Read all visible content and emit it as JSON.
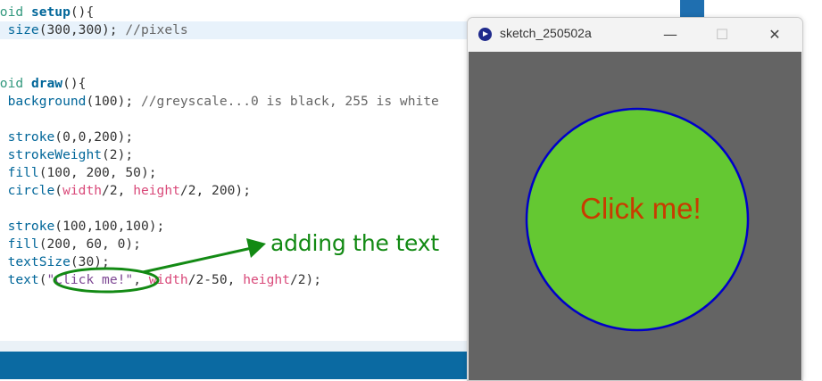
{
  "editor": {
    "lines": [
      [
        {
          "t": "void ",
          "c": "kw"
        },
        {
          "t": "setup",
          "c": "fn"
        },
        {
          "t": "(){",
          "c": ""
        }
      ],
      [
        {
          "t": "  ",
          "c": ""
        },
        {
          "t": "size",
          "c": "fc"
        },
        {
          "t": "(300,300); ",
          "c": ""
        },
        {
          "t": "//pixels",
          "c": "cm"
        }
      ],
      [
        {
          "t": "}",
          "c": ""
        }
      ],
      [
        {
          "t": "",
          "c": ""
        }
      ],
      [
        {
          "t": "void ",
          "c": "kw"
        },
        {
          "t": "draw",
          "c": "fn"
        },
        {
          "t": "(){",
          "c": ""
        }
      ],
      [
        {
          "t": "  ",
          "c": ""
        },
        {
          "t": "background",
          "c": "fc"
        },
        {
          "t": "(100); ",
          "c": ""
        },
        {
          "t": "//greyscale...0 is black, 255 is white",
          "c": "cm"
        }
      ],
      [
        {
          "t": "",
          "c": ""
        }
      ],
      [
        {
          "t": "  ",
          "c": ""
        },
        {
          "t": "stroke",
          "c": "fc"
        },
        {
          "t": "(0,0,200);",
          "c": ""
        }
      ],
      [
        {
          "t": "  ",
          "c": ""
        },
        {
          "t": "strokeWeight",
          "c": "fc"
        },
        {
          "t": "(2);",
          "c": ""
        }
      ],
      [
        {
          "t": "  ",
          "c": ""
        },
        {
          "t": "fill",
          "c": "fc"
        },
        {
          "t": "(100, 200, 50);",
          "c": ""
        }
      ],
      [
        {
          "t": "  ",
          "c": ""
        },
        {
          "t": "circle",
          "c": "fc"
        },
        {
          "t": "(",
          "c": ""
        },
        {
          "t": "width",
          "c": "var"
        },
        {
          "t": "/2, ",
          "c": ""
        },
        {
          "t": "height",
          "c": "var"
        },
        {
          "t": "/2, 200);",
          "c": ""
        }
      ],
      [
        {
          "t": "",
          "c": ""
        }
      ],
      [
        {
          "t": "  ",
          "c": ""
        },
        {
          "t": "stroke",
          "c": "fc"
        },
        {
          "t": "(100,100,100);",
          "c": ""
        }
      ],
      [
        {
          "t": "  ",
          "c": ""
        },
        {
          "t": "fill",
          "c": "fc"
        },
        {
          "t": "(200, 60, 0);",
          "c": ""
        }
      ],
      [
        {
          "t": "  ",
          "c": ""
        },
        {
          "t": "textSize",
          "c": "fc"
        },
        {
          "t": "(30);",
          "c": ""
        }
      ],
      [
        {
          "t": "  ",
          "c": ""
        },
        {
          "t": "text",
          "c": "fc"
        },
        {
          "t": "(",
          "c": ""
        },
        {
          "t": "\"Click me!\"",
          "c": "str"
        },
        {
          "t": ", ",
          "c": ""
        },
        {
          "t": "width",
          "c": "var"
        },
        {
          "t": "/2-50, ",
          "c": ""
        },
        {
          "t": "height",
          "c": "var"
        },
        {
          "t": "/2);",
          "c": ""
        }
      ],
      [
        {
          "t": "}",
          "c": ""
        }
      ]
    ],
    "highlighted_line": 1
  },
  "annotation": {
    "text": "adding the text",
    "color": "#138a14"
  },
  "sketch_window": {
    "title": "sketch_250502a",
    "minimize_glyph": "—",
    "maximize_glyph": "☐",
    "close_glyph": "✕",
    "canvas_background": "#646464",
    "circle_fill": "#64c832",
    "circle_stroke": "#0000c8",
    "label": "Click me!",
    "label_color": "#c83c00"
  },
  "colors": {
    "editor_scrollbar_thumb": "#1f6fb0",
    "console_bar": "#0b6aa2"
  }
}
